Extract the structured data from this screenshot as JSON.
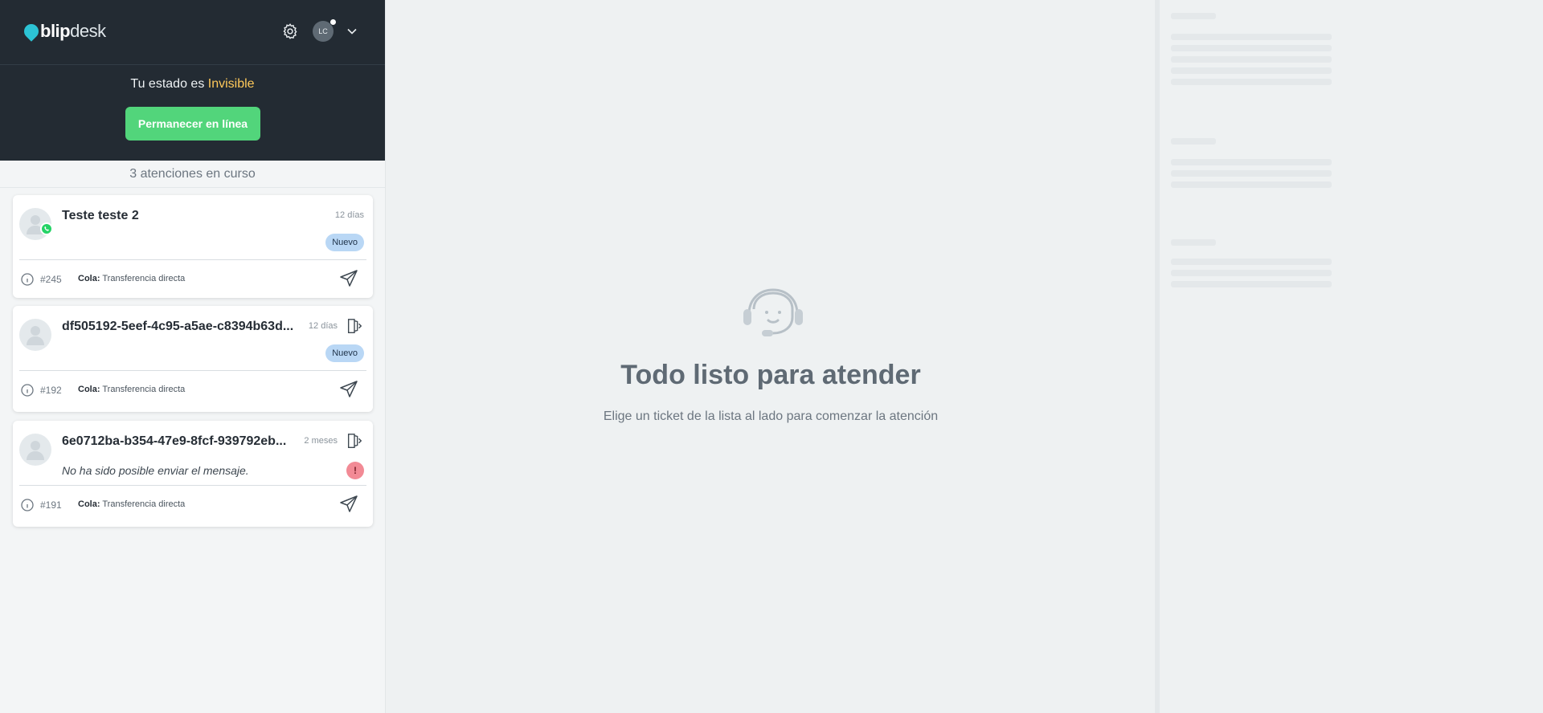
{
  "header": {
    "brand_bold": "blip",
    "brand_light": "desk",
    "avatar_initials": "LC"
  },
  "status": {
    "prefix": "Tu estado es ",
    "state": "Invisible",
    "button_label": "Permanecer en línea"
  },
  "queue_count_label": "3 atenciones en curso",
  "tickets": [
    {
      "name": "Teste teste 2",
      "time": "12 días",
      "badge": "Nuevo",
      "id": "#245",
      "queue_label": "Cola:",
      "queue_value": "Transferencia directa"
    },
    {
      "name": "df505192-5eef-4c95-a5ae-c8394b63d...",
      "time": "12 días",
      "badge": "Nuevo",
      "id": "#192",
      "queue_label": "Cola:",
      "queue_value": "Transferencia directa"
    },
    {
      "name": "6e0712ba-b354-47e9-8fcf-939792eb...",
      "time": "2 meses",
      "message": "No ha sido posible enviar el mensaje.",
      "error_badge": "!",
      "id": "#191",
      "queue_label": "Cola:",
      "queue_value": "Transferencia directa"
    }
  ],
  "empty_state": {
    "title": "Todo listo para atender",
    "subtitle": "Elige un ticket de la lista al lado para comenzar la atención"
  },
  "colors": {
    "sidebar_header": "#232b33",
    "status_accent": "#ffc95a",
    "online_button": "#52d57b",
    "badge_new": "#b9d7f5",
    "error_badge": "#f28a95",
    "whatsapp": "#25d366"
  },
  "icons": {
    "settings": "gear-icon",
    "dropdown": "chevron-down-icon",
    "channel": "whatsapp-icon",
    "transfer": "exit-door-icon",
    "info": "info-icon",
    "send": "send-icon",
    "empty": "headset-agent-icon"
  }
}
